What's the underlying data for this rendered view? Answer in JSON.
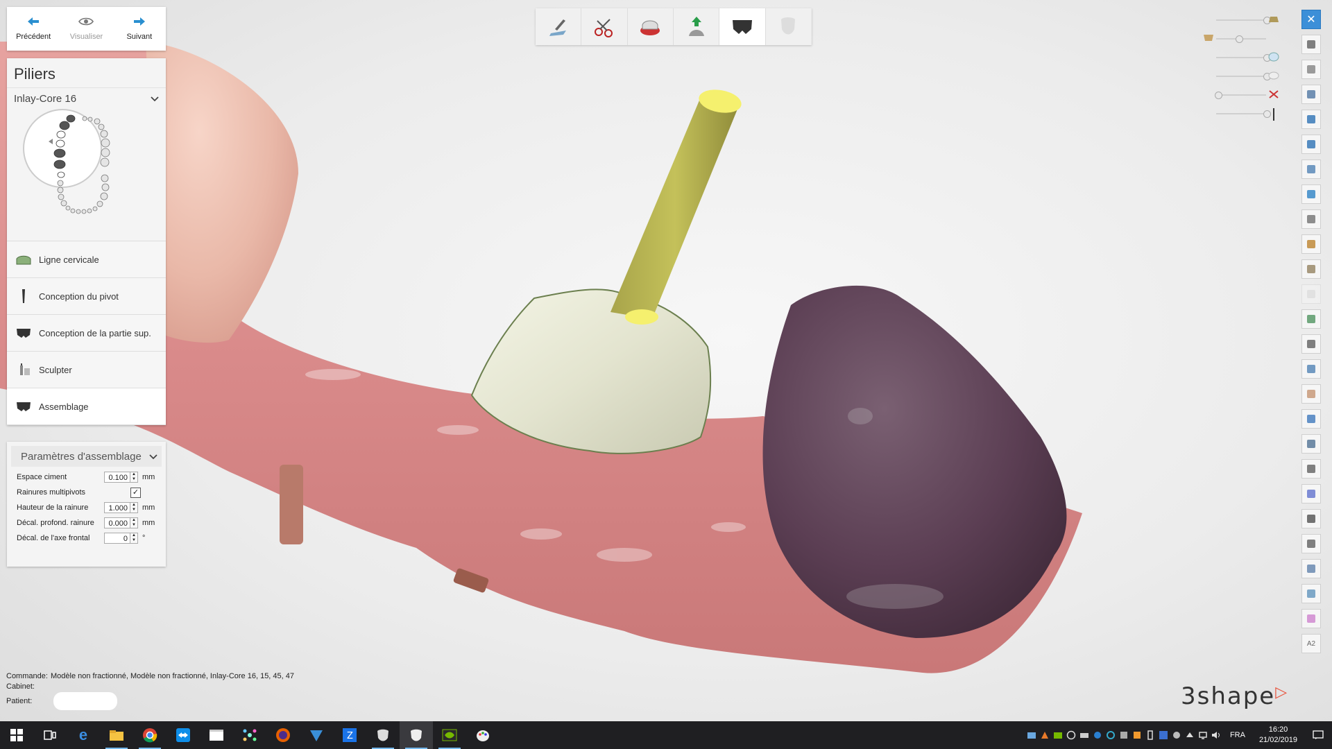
{
  "nav": {
    "previous": "Précédent",
    "view": "Visualiser",
    "next": "Suivant"
  },
  "panel": {
    "title": "Piliers",
    "case": "Inlay-Core 16",
    "steps": [
      {
        "label": "Ligne cervicale",
        "icon": "gingiva-icon",
        "active": false
      },
      {
        "label": "Conception du pivot",
        "icon": "post-icon",
        "active": false
      },
      {
        "label": "Conception de la partie sup.",
        "icon": "core-icon",
        "active": false
      },
      {
        "label": "Sculpter",
        "icon": "sculpt-icon",
        "active": false
      },
      {
        "label": "Assemblage",
        "icon": "assembly-icon",
        "active": true
      }
    ]
  },
  "params": {
    "title": "Paramètres d'assemblage",
    "rows": {
      "cement": {
        "label": "Espace ciment",
        "value": "0.100",
        "unit": "mm"
      },
      "grooves": {
        "label": "Rainures multipivots",
        "checked": true
      },
      "groove_height": {
        "label": "Hauteur de la rainure",
        "value": "1.000",
        "unit": "mm"
      },
      "groove_offset": {
        "label": "Décal. profond. rainure",
        "value": "0.000",
        "unit": "mm"
      },
      "axis_offset": {
        "label": "Décal. de l'axe frontal",
        "value": "0",
        "unit": "°"
      }
    }
  },
  "toolbar_top": [
    "prep-scan-icon",
    "cut-tool-icon",
    "die-icon",
    "insertion-icon",
    "core-design-icon",
    "crown-icon"
  ],
  "sliders": [
    {
      "icon": "prep-model-icon",
      "level": 1.0
    },
    {
      "icon": "antagonist-icon",
      "level": 0.45
    },
    {
      "icon": "crown-transparency-icon",
      "level": 1.0
    },
    {
      "icon": "tooth-outline-icon",
      "level": 1.0
    },
    {
      "icon": "clip-scissors-icon",
      "level": 0.05
    },
    {
      "icon": "post-slider-icon",
      "level": 1.0
    }
  ],
  "toolbar_right": [
    "close-icon",
    "fit-view-icon",
    "rotate-view-icon",
    "education-icon",
    "view-front-icon",
    "view-back-icon",
    "view-left-icon",
    "view-right-icon",
    "measure-icon",
    "sculpt-tool-icon",
    "wax-knife-icon",
    "disabled-tool-icon",
    "model-tool-icon",
    "section-icon",
    "cylinder-icon",
    "face-photo-icon",
    "warning-icon",
    "screen-icon",
    "camera-icon",
    "color-tool-icon",
    "shield-icon",
    "axis-icon",
    "ruler-icon",
    "scan-icon",
    "color-wheel-icon"
  ],
  "toolbar_right_label": "A2",
  "info": {
    "order_label": "Commande:",
    "order_value": "Modèle non fractionné, Modèle non fractionné, Inlay-Core 16, 15, 45, 47",
    "lab_label": "Cabinet:",
    "lab_value": "",
    "patient_label": "Patient:",
    "patient_value": ""
  },
  "logo": "3shape",
  "taskbar": {
    "apps": [
      "windows-start-icon",
      "task-view-icon",
      "edge-icon",
      "file-explorer-icon",
      "chrome-icon",
      "teamviewer-icon",
      "video-editor-icon",
      "network-app-icon",
      "firefox-icon",
      "vpn-icon",
      "zoom-icon",
      "dental-app-icon",
      "dental-app-active-icon",
      "nvidia-icon",
      "paint-icon"
    ],
    "tray_icons": [
      "tray-1-icon",
      "tray-2-icon",
      "tray-3-icon",
      "tray-4-icon",
      "tray-5-icon",
      "tray-6-icon",
      "tray-7-icon",
      "tray-8-icon",
      "tray-9-icon",
      "tray-10-icon",
      "tray-11-icon",
      "tray-12-icon",
      "tray-13-icon",
      "network-icon",
      "volume-icon"
    ],
    "language": "FRA",
    "time": "16:20",
    "date": "21/02/2019"
  },
  "colors": {
    "accent": "#2a8fd0",
    "post": "#c4c15a",
    "core": "#e3e4cf",
    "gum": "#d98a8a",
    "tooth_dark": "#5b3e53",
    "taskbar": "#1f1f22",
    "logo_accent": "#e8553f"
  }
}
